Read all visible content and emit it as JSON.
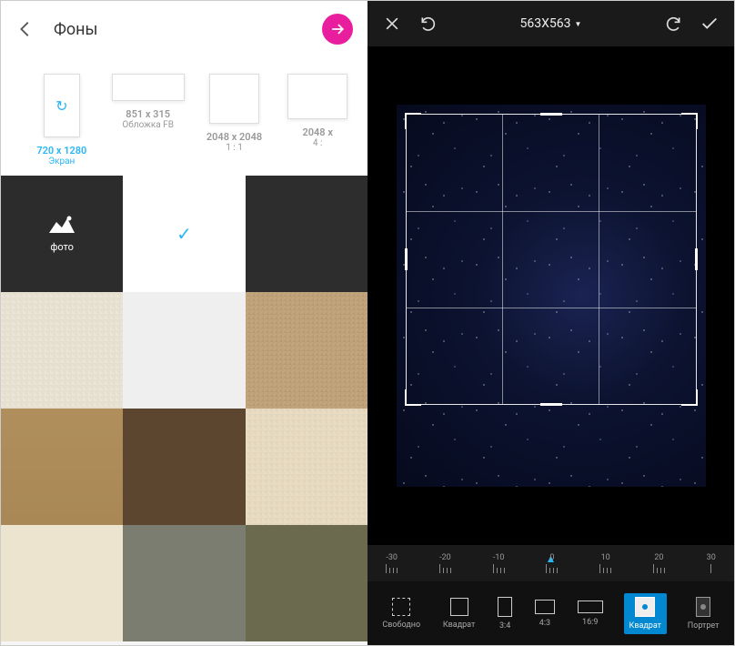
{
  "left": {
    "title": "Фоны",
    "sizes": [
      {
        "label": "720 x 1280",
        "sub": "Экран",
        "selected": true
      },
      {
        "label": "851 x 315",
        "sub": "Обложка FB",
        "selected": false
      },
      {
        "label": "2048 x 2048",
        "sub": "1 : 1",
        "selected": false
      },
      {
        "label": "2048 x",
        "sub": "4 :",
        "selected": false
      }
    ],
    "photo_label": "фото"
  },
  "right": {
    "dimensions": "563X563",
    "ruler_marks": [
      "-30",
      "-20",
      "-10",
      "0",
      "10",
      "20",
      "30"
    ],
    "ratios": [
      {
        "label": "Свободно"
      },
      {
        "label": "Квадрат"
      },
      {
        "label": "3:4"
      },
      {
        "label": "4:3"
      },
      {
        "label": "16:9"
      },
      {
        "label": "Квадрат"
      },
      {
        "label": "Портрет"
      }
    ]
  }
}
